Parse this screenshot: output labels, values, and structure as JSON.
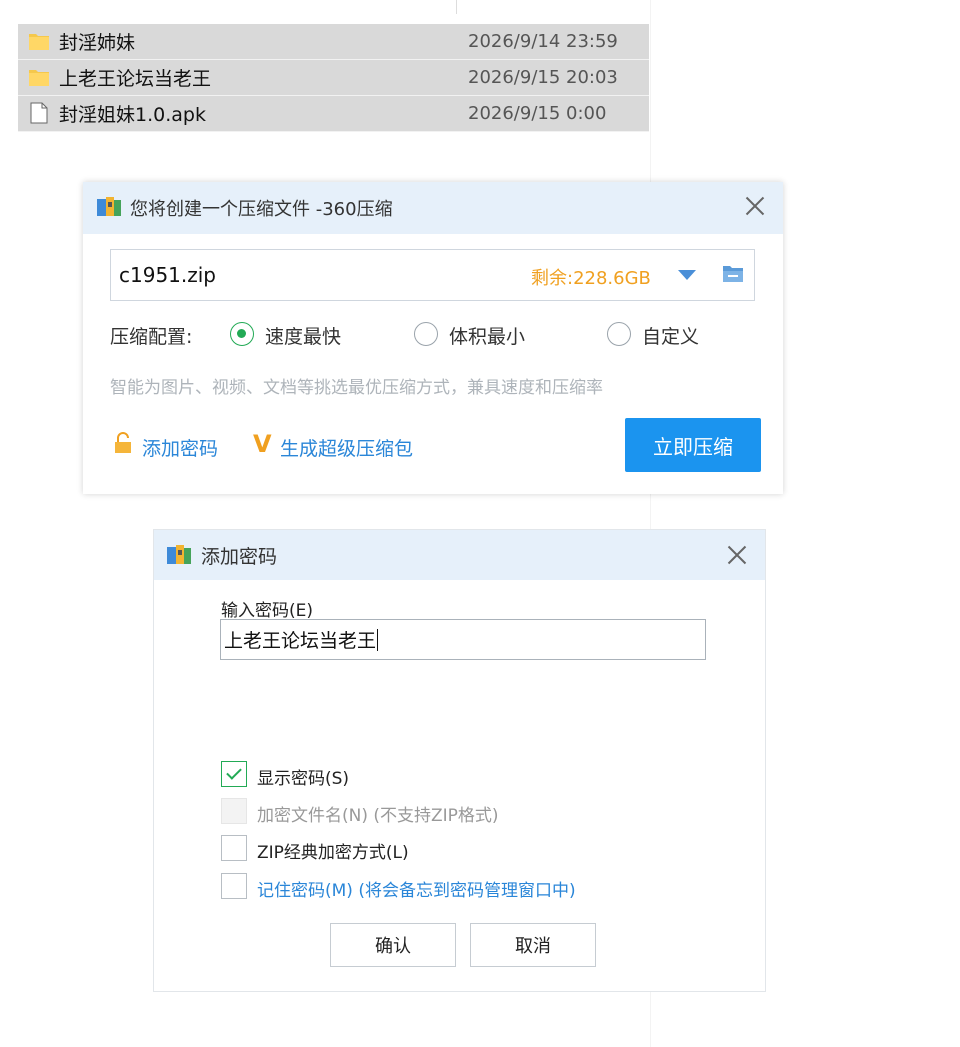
{
  "file_list": [
    {
      "icon": "folder-icon",
      "name": "封淫姉妹",
      "date": "2026/9/14 23:59"
    },
    {
      "icon": "folder-icon",
      "name": "上老王论坛当老王",
      "date": "2026/9/15 20:03"
    },
    {
      "icon": "file-icon",
      "name": "封淫姐妹1.0.apk",
      "date": "2026/9/15 0:00"
    }
  ],
  "compress_dialog": {
    "title": "您将创建一个压缩文件 -360压缩",
    "filename": "c1951.zip",
    "free_space": "剩余:228.6GB",
    "config_label": "压缩配置:",
    "options": [
      {
        "label": "速度最快",
        "selected": true
      },
      {
        "label": "体积最小",
        "selected": false
      },
      {
        "label": "自定义",
        "selected": false
      }
    ],
    "hint": "智能为图片、视频、文档等挑选最优压缩方式，兼具速度和压缩率",
    "add_password": "添加密码",
    "super_pack": "生成超级压缩包",
    "compress_button": "立即压缩"
  },
  "password_dialog": {
    "title": "添加密码",
    "input_label": "输入密码(E)",
    "password_value": "上老王论坛当老王",
    "checkboxes": [
      {
        "label": "显示密码(S)",
        "checked": true,
        "disabled": false
      },
      {
        "label": "加密文件名(N) (不支持ZIP格式)",
        "checked": false,
        "disabled": true
      },
      {
        "label": "ZIP经典加密方式(L)",
        "checked": false,
        "disabled": false
      },
      {
        "label": "记住密码(M) (将会备忘到密码管理窗口中)",
        "checked": false,
        "disabled": false
      }
    ],
    "ok_button": "确认",
    "cancel_button": "取消"
  },
  "colors": {
    "title_bar": "#e6f0fa",
    "accent_blue": "#1b94ef",
    "link_blue": "#2a86d8",
    "free_space_orange": "#f0a020",
    "check_green": "#22aa55"
  }
}
